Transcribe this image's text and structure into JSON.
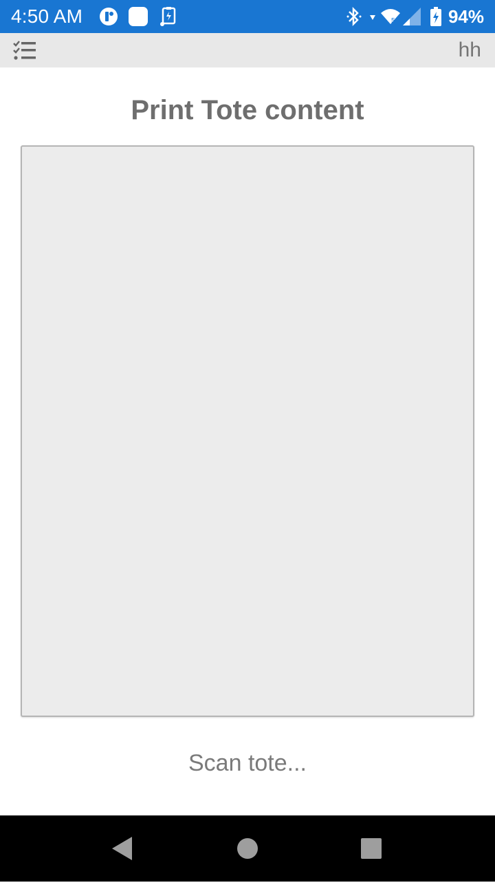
{
  "status_bar": {
    "time": "4:50 AM",
    "battery": "94%",
    "background_color": "#1976d2",
    "icons": [
      "app-notification-icon",
      "white-square-icon",
      "charging-clipboard-icon",
      "bluetooth-icon",
      "data-arrow-icon",
      "wifi-icon",
      "signal-icon",
      "battery-charging-icon"
    ]
  },
  "toolbar": {
    "menu_icon": "checklist-menu-icon",
    "user": "hh"
  },
  "page": {
    "title": "Print Tote content"
  },
  "scan": {
    "placeholder": "Scan tote...",
    "value": ""
  },
  "navigation": {
    "icons": [
      "back-icon",
      "home-icon",
      "recents-icon"
    ]
  }
}
